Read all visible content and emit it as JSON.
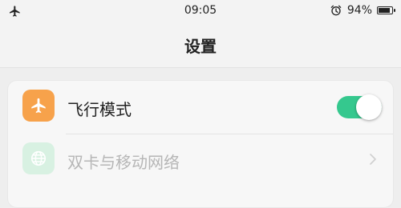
{
  "status_bar": {
    "left_icon": "airplane-icon",
    "time": "09:05",
    "alarm_icon": "alarm-clock-icon",
    "battery_percent": "94%",
    "battery_level": 0.94
  },
  "header": {
    "title": "设置"
  },
  "settings": {
    "items": [
      {
        "label": "飞行模式",
        "icon": "airplane-icon",
        "icon_bg": "#f7a24b",
        "label_color": "#222222",
        "control": "toggle",
        "toggle_on": true,
        "toggle_color": "#35c88e"
      },
      {
        "label": "双卡与移动网络",
        "icon": "globe-icon",
        "icon_bg": "#d8f1e2",
        "label_color": "#b6b6b6",
        "control": "chevron"
      }
    ]
  }
}
